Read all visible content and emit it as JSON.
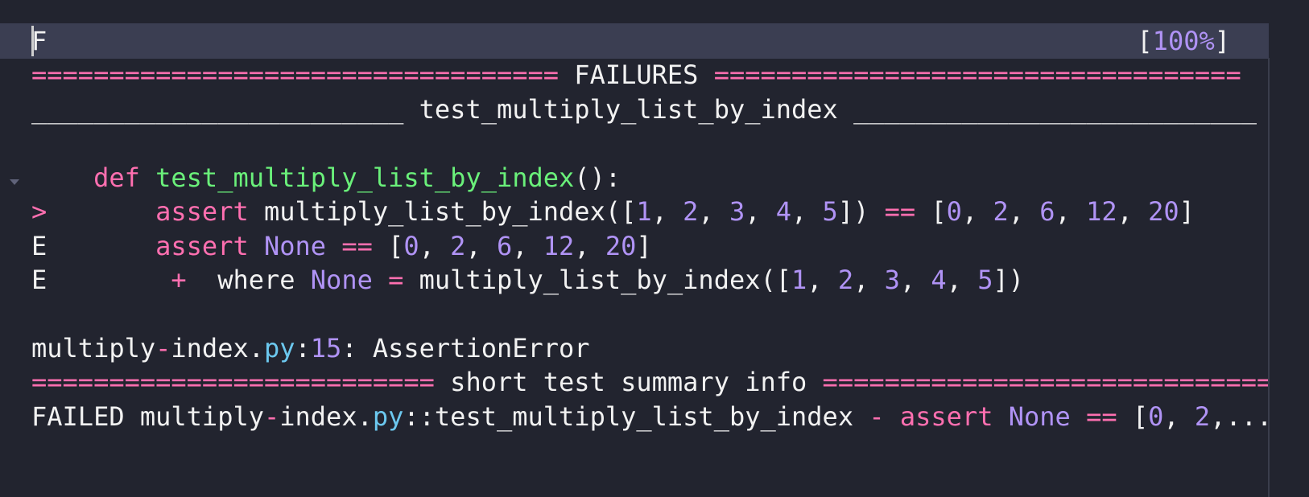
{
  "progress": {
    "status_char": "F",
    "open_bracket": "[",
    "percent": "100%",
    "close_bracket": "]"
  },
  "failures_header": {
    "left_rule": "==================================",
    "title": " FAILURES ",
    "right_rule": "=================================="
  },
  "test_header": {
    "left_rule": "________________________",
    "title": " test_multiply_list_by_index ",
    "right_rule": "__________________________"
  },
  "code": {
    "def_keyword": "def",
    "func_name": "test_multiply_list_by_index",
    "func_tail": "():",
    "arrow_marker": ">",
    "assert_keyword": "assert",
    "call_open": "multiply_list_by_index([",
    "args": [
      "1",
      "2",
      "3",
      "4",
      "5"
    ],
    "call_close": "])",
    "op_eq": "==",
    "expected": [
      "0",
      "2",
      "6",
      "12",
      "20"
    ],
    "error_marker": "E",
    "none": "None",
    "plus": "+",
    "where": "where",
    "eq": "="
  },
  "location": {
    "file_stem": "multiply",
    "dash": "-",
    "file_rest": "index.",
    "ext": "py",
    "colon": ":",
    "line_no": "15",
    "error": ": AssertionError"
  },
  "summary_header": {
    "left_rule": "==========================",
    "title": " short test summary info ",
    "right_rule": "============================="
  },
  "summary_line": {
    "failed": "FAILED",
    "path_stem": "multiply",
    "dash": "-",
    "path_rest": "index.",
    "ext": "py",
    "test_id": "::test_multiply_list_by_index",
    "sep": "-",
    "assert_keyword": "assert",
    "none": "None",
    "op_eq": "==",
    "bracket": "[",
    "first": "0",
    "second": "2",
    "ellipsis": ",..."
  },
  "colors": {
    "background": "#22242f",
    "highlight_row": "#3b3e52",
    "pink": "#ff6fb0",
    "green": "#6af07a",
    "purple": "#b093f5",
    "cyan": "#6cc8ef",
    "text": "#f2f2f2"
  }
}
